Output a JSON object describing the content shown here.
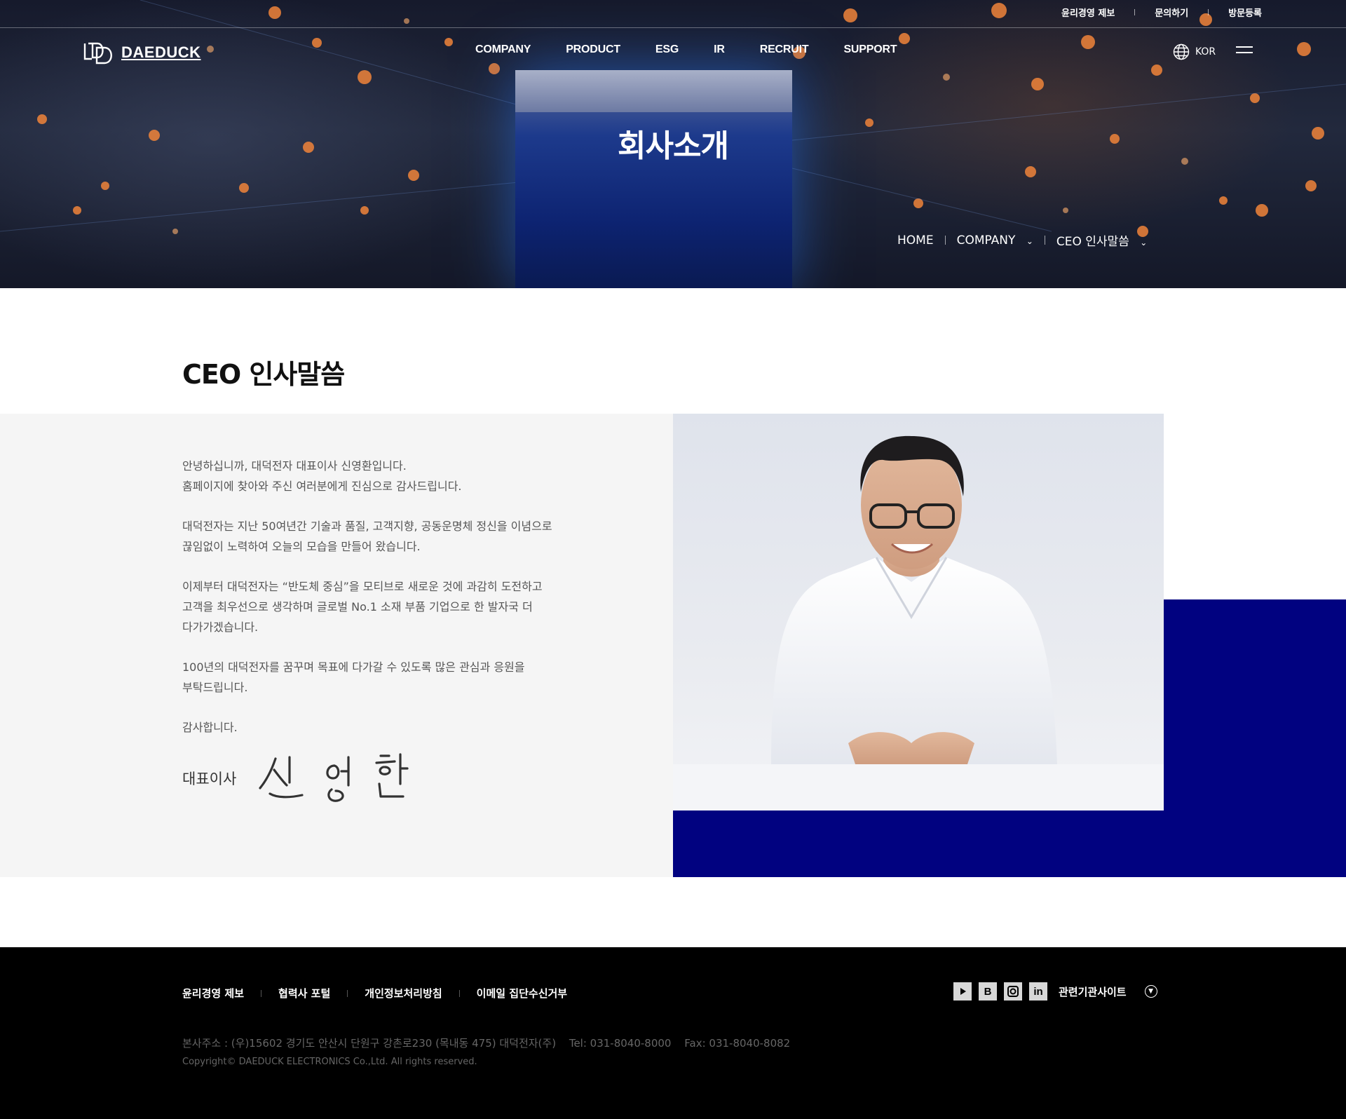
{
  "util_nav": [
    "윤리경영 제보",
    "문의하기",
    "방문등록"
  ],
  "logo": {
    "text": "DAEDUCK"
  },
  "gnb": [
    "COMPANY",
    "PRODUCT",
    "ESG",
    "IR",
    "RECRUIT",
    "SUPPORT"
  ],
  "lang": {
    "label": "KOR",
    "icon": "globe-icon"
  },
  "hero": {
    "title": "회사소개",
    "breadcrumb": {
      "home": "HOME",
      "section": "COMPANY",
      "page": "CEO 인사말씀"
    }
  },
  "content": {
    "title": "CEO 인사말씀",
    "paragraphs": [
      "안녕하십니까, 대덕전자 대표이사 신영환입니다.\n홈페이지에 찾아와 주신 여러분에게 진심으로 감사드립니다.",
      "대덕전자는 지난 50여년간 기술과 품질, 고객지향, 공동운명체 정신을 이념으로\n끊임없이 노력하여 오늘의 모습을 만들어 왔습니다.",
      "이제부터 대덕전자는 “반도체 중심”을 모티브로 새로운 것에 과감히 도전하고\n고객을 최우선으로 생각하며 글로벌 No.1 소재 부품 기업으로 한 발자국 더\n다가가겠습니다.",
      "100년의 대덕전자를 꿈꾸며 목표에 다가갈 수 있도록 많은 관심과 응원을\n부탁드립니다.",
      "감사합니다."
    ],
    "signature": {
      "role": "대표이사",
      "name": "신영환"
    }
  },
  "footer": {
    "links": [
      "윤리경영 제보",
      "협력사 포털",
      "개인정보처리방침",
      "이메일 집단수신거부"
    ],
    "social": [
      "youtube-icon",
      "blog-icon",
      "instagram-icon",
      "linkedin-icon"
    ],
    "family_site": "관련기관사이트",
    "address": "본사주소 : (우)15602 경기도 안산시 단원구 강촌로230 (목내동 475) 대덕전자(주)",
    "tel": "Tel: 031-8040-8000",
    "fax": "Fax: 031-8040-8082",
    "copyright": "Copyright© DAEDUCK ELECTRONICS Co.,Ltd. All rights reserved."
  },
  "colors": {
    "accent_blue": "#010280",
    "footer_bg": "#000000",
    "panel_bg": "#f5f5f5"
  }
}
